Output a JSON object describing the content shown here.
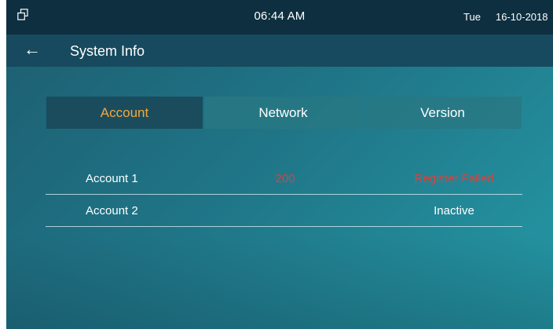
{
  "status_bar": {
    "time": "06:44 AM",
    "day": "Tue",
    "date": "16-10-2018",
    "left_icon": "window-restore-icon"
  },
  "title_bar": {
    "back_icon": "back-arrow-icon",
    "title": "System Info"
  },
  "tabs": [
    {
      "label": "Account",
      "active": true
    },
    {
      "label": "Network",
      "active": false
    },
    {
      "label": "Version",
      "active": false
    }
  ],
  "accounts": [
    {
      "name": "Account 1",
      "number": "200",
      "status": "Register Failed",
      "status_color": "#d6443f"
    },
    {
      "name": "Account 2",
      "number": "",
      "status": "Inactive",
      "status_color": "#ffffff"
    }
  ],
  "colors": {
    "active_tab_text": "#f4a83a",
    "error_text": "#d6443f",
    "status_bar_bg": "#0e2f40",
    "title_bar_bg": "#174a5e"
  }
}
